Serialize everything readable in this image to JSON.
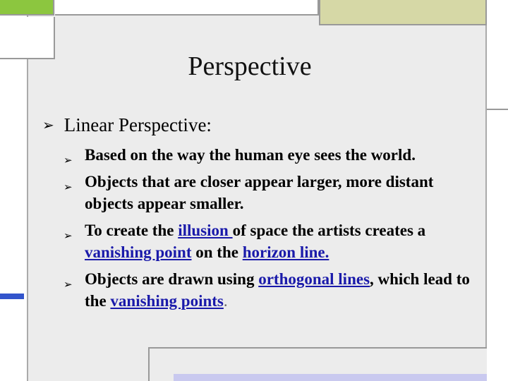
{
  "slide": {
    "title": "Perspective",
    "main_bullet": "Linear Perspective:",
    "sub_bullets": [
      {
        "text": "Based on the way the human eye sees the world."
      },
      {
        "text": "Objects that are closer appear larger, more distant objects appear smaller."
      },
      {
        "before": "To create the ",
        "link1": "illusion ",
        "middle": "of space the artists creates a ",
        "link2": "vanishing point",
        "middle2": " on the ",
        "link3": "horizon line."
      },
      {
        "before": "Objects are drawn using ",
        "link1": "orthogonal lines",
        "middle": ", which lead to the ",
        "link2": "vanishing points",
        "after": "."
      }
    ],
    "bullet_glyph": "➢"
  },
  "colors": {
    "green_block": "#8cc63f",
    "olive_block": "#d6d8a6",
    "blue_block": "#3355cc",
    "lavender_strip": "#c9c9ef",
    "link": "#1a1aaa",
    "background": "#ececec"
  }
}
